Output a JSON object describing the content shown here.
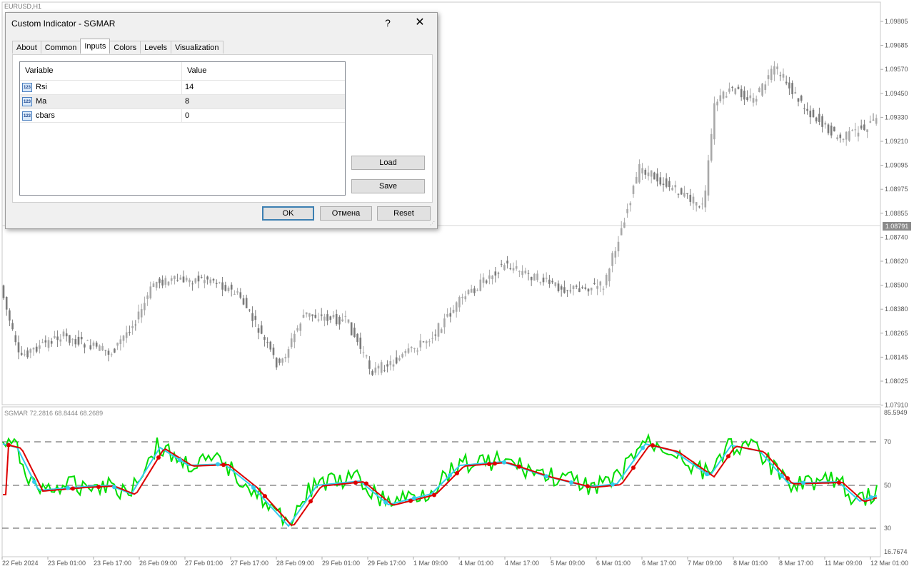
{
  "chart": {
    "symbol": "EURUSD,H1",
    "current_price": "1.08791",
    "price_axis": [
      "1.09805",
      "1.09685",
      "1.09570",
      "1.09450",
      "1.09330",
      "1.09210",
      "1.09095",
      "1.08975",
      "1.08855",
      "1.08740",
      "1.08620",
      "1.08500",
      "1.08380",
      "1.08265",
      "1.08145",
      "1.08025",
      "1.07910"
    ],
    "time_axis": [
      "22 Feb 2024",
      "23 Feb 01:00",
      "23 Feb 17:00",
      "26 Feb 09:00",
      "27 Feb 01:00",
      "27 Feb 17:00",
      "28 Feb 09:00",
      "29 Feb 01:00",
      "29 Feb 17:00",
      "1 Mar 09:00",
      "4 Mar 01:00",
      "4 Mar 17:00",
      "5 Mar 09:00",
      "6 Mar 01:00",
      "6 Mar 17:00",
      "7 Mar 09:00",
      "8 Mar 01:00",
      "8 Mar 17:00",
      "11 Mar 09:00",
      "12 Mar 01:00"
    ],
    "colors": {
      "candle_up": "#a8a8a8",
      "candle_down": "#7a7a7a",
      "indicator_fast": "#00dd00",
      "indicator_signal": "#33ccee",
      "indicator_slow": "#dd0000"
    }
  },
  "indicator": {
    "label": "SGMAR 72.2816 68.8444 68.2689",
    "axis": [
      "85.5949",
      "70",
      "50",
      "30",
      "16.7674"
    ]
  },
  "dialog": {
    "title": "Custom Indicator - SGMAR",
    "help": "?",
    "close": "✕",
    "tabs": [
      "About",
      "Common",
      "Inputs",
      "Colors",
      "Levels",
      "Visualization"
    ],
    "active_tab": "Inputs",
    "columns": {
      "variable": "Variable",
      "value": "Value"
    },
    "icon_text": "123",
    "rows": [
      {
        "variable": "Rsi",
        "value": "14"
      },
      {
        "variable": "Ma",
        "value": "8"
      },
      {
        "variable": "cbars",
        "value": "0"
      }
    ],
    "load_label": "Load",
    "save_label": "Save",
    "ok_label": "OK",
    "cancel_label": "Отмена",
    "reset_label": "Reset"
  }
}
